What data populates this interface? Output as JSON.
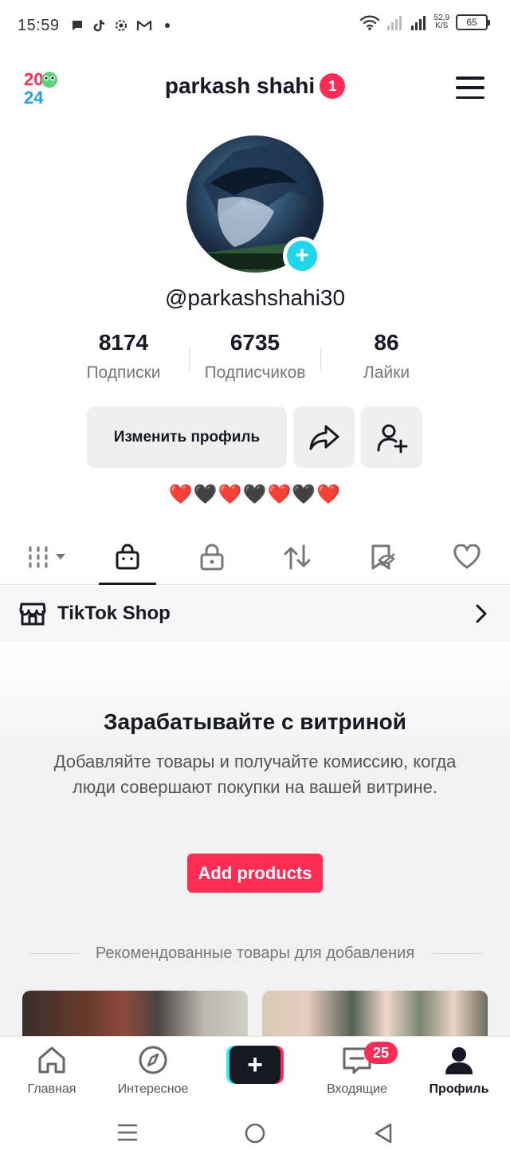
{
  "status_bar": {
    "time": "15:59",
    "net_speed_value": "52,9",
    "net_speed_unit": "K/S",
    "battery": "65"
  },
  "header": {
    "logo_top": "20",
    "logo_bottom": "24",
    "username": "parkash shahi",
    "notification_count": "1"
  },
  "profile": {
    "handle": "@parkashshahi30",
    "stats": [
      {
        "value": "8174",
        "label": "Подписки"
      },
      {
        "value": "6735",
        "label": "Подписчиков"
      },
      {
        "value": "86",
        "label": "Лайки"
      }
    ],
    "edit_button": "Изменить профиль",
    "bio": "❤️🖤❤️🖤❤️🖤❤️"
  },
  "tabs": {
    "items": [
      "grid-icon",
      "shop-bag-icon",
      "lock-icon",
      "repost-icon",
      "saved-hidden-icon",
      "heart-icon"
    ],
    "active": "shop-bag-icon"
  },
  "shop": {
    "label": "TikTok Shop"
  },
  "promo": {
    "title": "Зарабатывайте с витриной",
    "description": "Добавляйте товары и получайте комиссию, когда люди совершают покупки на вашей витрине.",
    "button": "Add products",
    "recommended": "Рекомендованные товары для добавления"
  },
  "bottom_nav": {
    "home": "Главная",
    "discover": "Интересное",
    "create": "+",
    "inbox": "Входящие",
    "inbox_badge": "25",
    "profile": "Профиль"
  },
  "colors": {
    "accent": "#fe2c55",
    "cyan": "#20d5ec",
    "text": "#161823"
  }
}
